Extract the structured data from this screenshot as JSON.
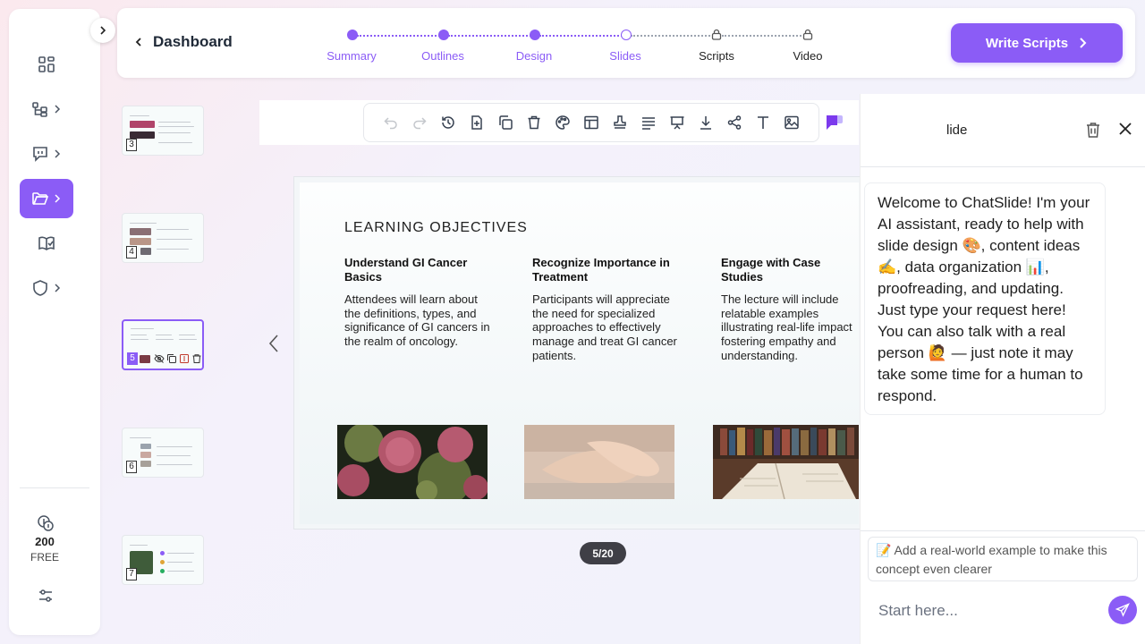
{
  "header": {
    "back_label": "Dashboard",
    "steps": [
      "Summary",
      "Outlines",
      "Design",
      "Slides",
      "Scripts",
      "Video"
    ],
    "primary_button": "Write Scripts"
  },
  "sidebar": {
    "credits_amount": "200",
    "credits_plan": "FREE"
  },
  "thumbnails": [
    "3",
    "4",
    "5",
    "6",
    "7"
  ],
  "slide": {
    "title": "LEARNING OBJECTIVES",
    "columns": [
      {
        "heading": "Understand GI Cancer Basics",
        "body": "Attendees will learn about the definitions, types, and significance of GI cancers in the realm of oncology."
      },
      {
        "heading": "Recognize Importance in Treatment",
        "body": "Participants will appreciate the need for specialized approaches to effectively manage and treat GI cancer patients."
      },
      {
        "heading": "Engage with Case Studies",
        "body": "The lecture will include relatable examples illustrating real-life impact fostering empathy and understanding."
      }
    ],
    "page_indicator": "5/20"
  },
  "chat": {
    "title": "lide",
    "welcome": "Welcome to ChatSlide! I'm your AI assistant, ready to help with slide design 🎨, content ideas ✍️, data organization 📊, proofreading, and updating. Just type your request here! You can also talk with a real person 🙋 — just note it may take some time for a human to respond.",
    "suggestion": "📝 Add a real-world example to make this concept even clearer",
    "input_placeholder": "Start here..."
  },
  "colors": {
    "accent": "#8b5cf6",
    "page_pill": "#3f3f46"
  },
  "icons": {
    "rail": [
      "grid-icon",
      "outline-tree-icon",
      "presentation-chat-icon",
      "folder-open-icon",
      "book-check-icon",
      "shield-icon"
    ],
    "toolbar": [
      "undo-icon",
      "redo-icon",
      "history-icon",
      "add-page-icon",
      "duplicate-icon",
      "trash-icon",
      "palette-icon",
      "layout-icon",
      "stamp-icon",
      "align-icon",
      "present-icon",
      "download-icon",
      "share-icon",
      "text-icon",
      "image-icon"
    ]
  }
}
